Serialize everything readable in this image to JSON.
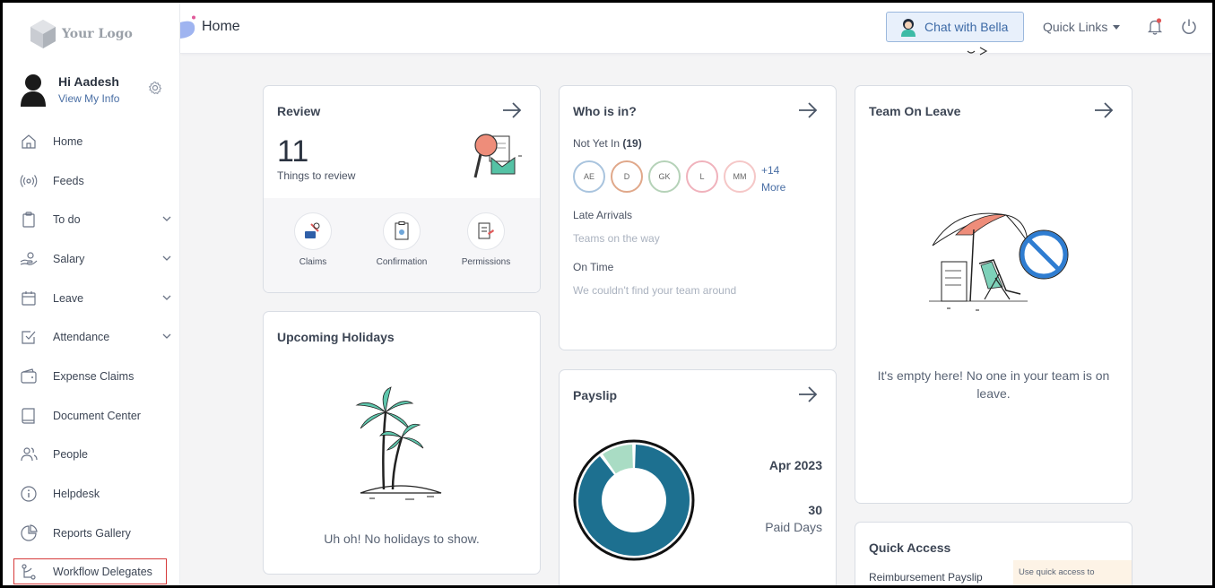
{
  "brand": {
    "logo_text": "Your Logo"
  },
  "profile": {
    "greeting": "Hi Aadesh",
    "link": "View My Info"
  },
  "sidebar": {
    "items": [
      {
        "label": "Home",
        "icon": "home-icon",
        "has_chevron": false
      },
      {
        "label": "Feeds",
        "icon": "broadcast-icon",
        "has_chevron": false
      },
      {
        "label": "To do",
        "icon": "clipboard-icon",
        "has_chevron": true
      },
      {
        "label": "Salary",
        "icon": "hand-coin-icon",
        "has_chevron": true
      },
      {
        "label": "Leave",
        "icon": "calendar-icon",
        "has_chevron": true
      },
      {
        "label": "Attendance",
        "icon": "checkbox-icon",
        "has_chevron": true
      },
      {
        "label": "Expense Claims",
        "icon": "wallet-icon",
        "has_chevron": false
      },
      {
        "label": "Document Center",
        "icon": "book-icon",
        "has_chevron": false
      },
      {
        "label": "People",
        "icon": "people-icon",
        "has_chevron": false
      },
      {
        "label": "Helpdesk",
        "icon": "info-icon",
        "has_chevron": false
      },
      {
        "label": "Reports Gallery",
        "icon": "pie-chart-icon",
        "has_chevron": false
      },
      {
        "label": "Workflow Delegates",
        "icon": "workflow-icon",
        "has_chevron": false,
        "highlighted": true
      }
    ]
  },
  "header": {
    "title": "Home",
    "chat_button": "Chat with Bella",
    "quick_links": "Quick Links",
    "notification_dot_color": "#e05555"
  },
  "review": {
    "title": "Review",
    "count": "11",
    "subtitle": "Things to review",
    "tools": [
      {
        "label": "Claims"
      },
      {
        "label": "Confirmation"
      },
      {
        "label": "Permissions"
      }
    ]
  },
  "who_is_in": {
    "title": "Who is in?",
    "not_yet_in_label": "Not Yet In",
    "not_yet_in_count": "(19)",
    "people": [
      {
        "initials": "AE",
        "color": "#a9c4de"
      },
      {
        "initials": "D",
        "color": "#e0a88a"
      },
      {
        "initials": "GK",
        "color": "#b5d2b8"
      },
      {
        "initials": "L",
        "color": "#f0b2bc"
      },
      {
        "initials": "MM",
        "color": "#f5c7c7"
      }
    ],
    "more_count": "+14",
    "more_label": "More",
    "late_label": "Late Arrivals",
    "late_msg": "Teams on the way",
    "on_time_label": "On Time",
    "on_time_msg": "We couldn't find your team around"
  },
  "team_on_leave": {
    "title": "Team On Leave",
    "empty_msg": "It's empty here! No one in your team is on leave."
  },
  "holidays": {
    "title": "Upcoming Holidays",
    "empty_msg": "Uh oh! No holidays to show."
  },
  "payslip": {
    "title": "Payslip",
    "period": "Apr 2023",
    "paid_days": "30",
    "paid_days_label": "Paid Days",
    "donut": {
      "main_fraction": 0.9,
      "main_color": "#1d7090",
      "minor_color": "#a9dcc4"
    }
  },
  "quick_access": {
    "title": "Quick Access",
    "item": "Reimbursement Payslip",
    "tip": "Use quick access to"
  }
}
